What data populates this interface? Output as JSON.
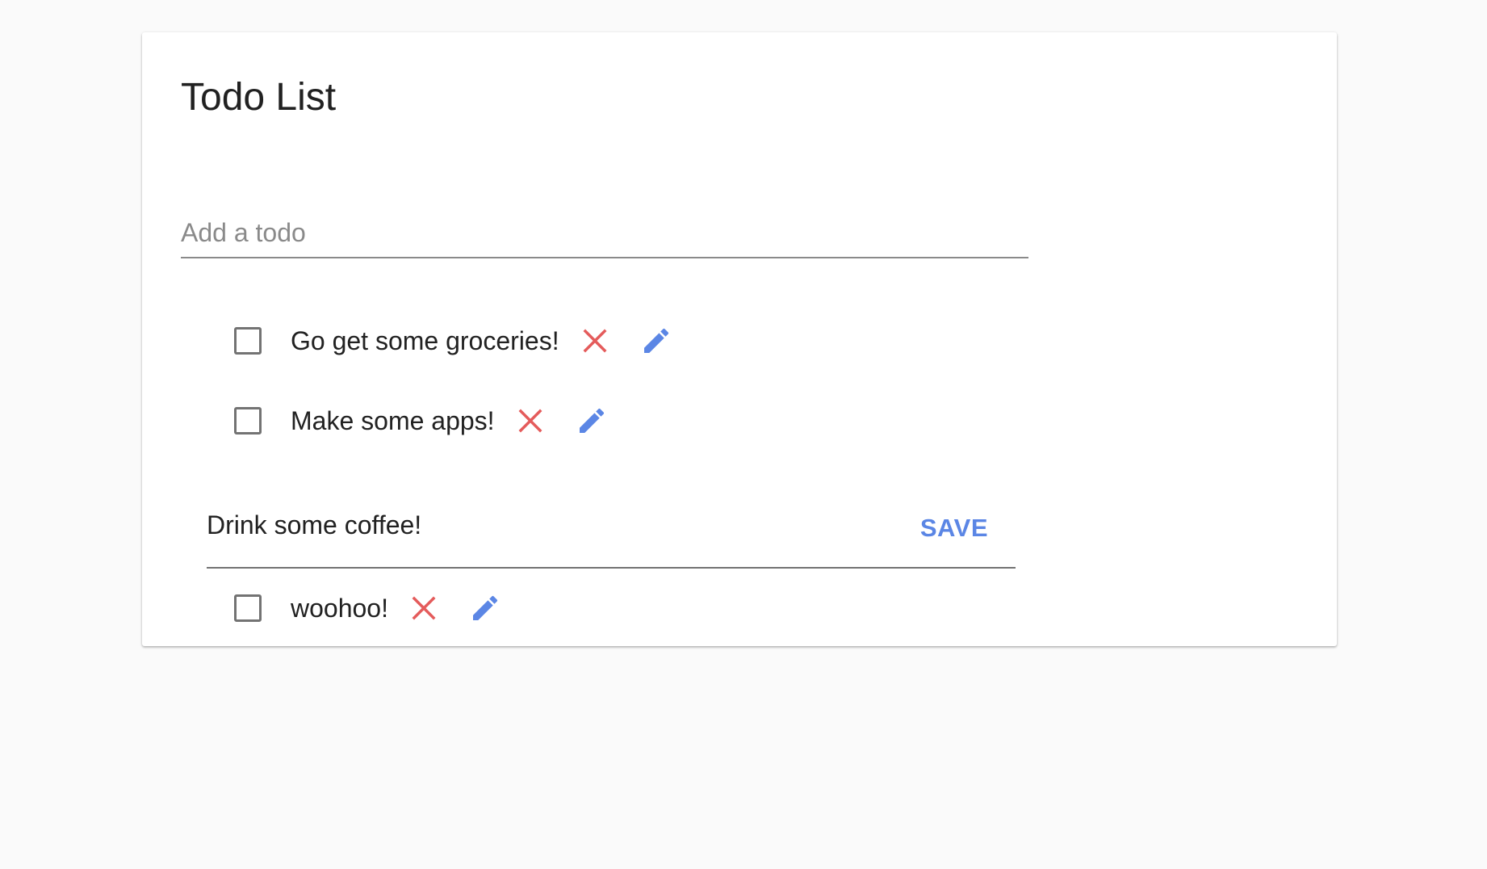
{
  "page": {
    "title": "Todo List"
  },
  "add_todo": {
    "placeholder": "Add a todo",
    "value": ""
  },
  "todos": [
    {
      "label": "Go get some groceries!",
      "checked": false
    },
    {
      "label": "Make some apps!",
      "checked": false
    },
    {
      "label": "woohoo!",
      "checked": false
    }
  ],
  "editing": {
    "value": "Drink some coffee!",
    "save_label": "SAVE"
  },
  "icons": {
    "delete": "close-icon",
    "edit": "pencil-icon"
  },
  "colors": {
    "delete": "#e45b5b",
    "edit": "#5b86e5",
    "save": "#5b86e5",
    "checkbox_border": "#737373"
  }
}
